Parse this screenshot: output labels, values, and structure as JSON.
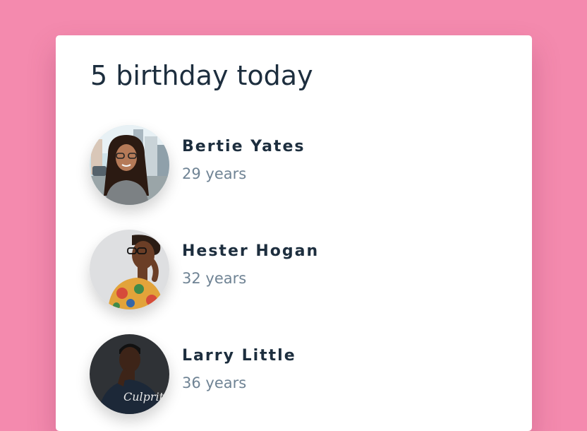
{
  "card": {
    "title": "5 birthday today"
  },
  "people": [
    {
      "name": "Bertie Yates",
      "age": "29 years"
    },
    {
      "name": "Hester Hogan",
      "age": "32 years"
    },
    {
      "name": "Larry Little",
      "age": "36 years",
      "shirt_text": "Culprit"
    }
  ],
  "colors": {
    "background": "#f48aae",
    "card": "#ffffff",
    "name": "#1d2e3e",
    "age": "#6f8394"
  }
}
